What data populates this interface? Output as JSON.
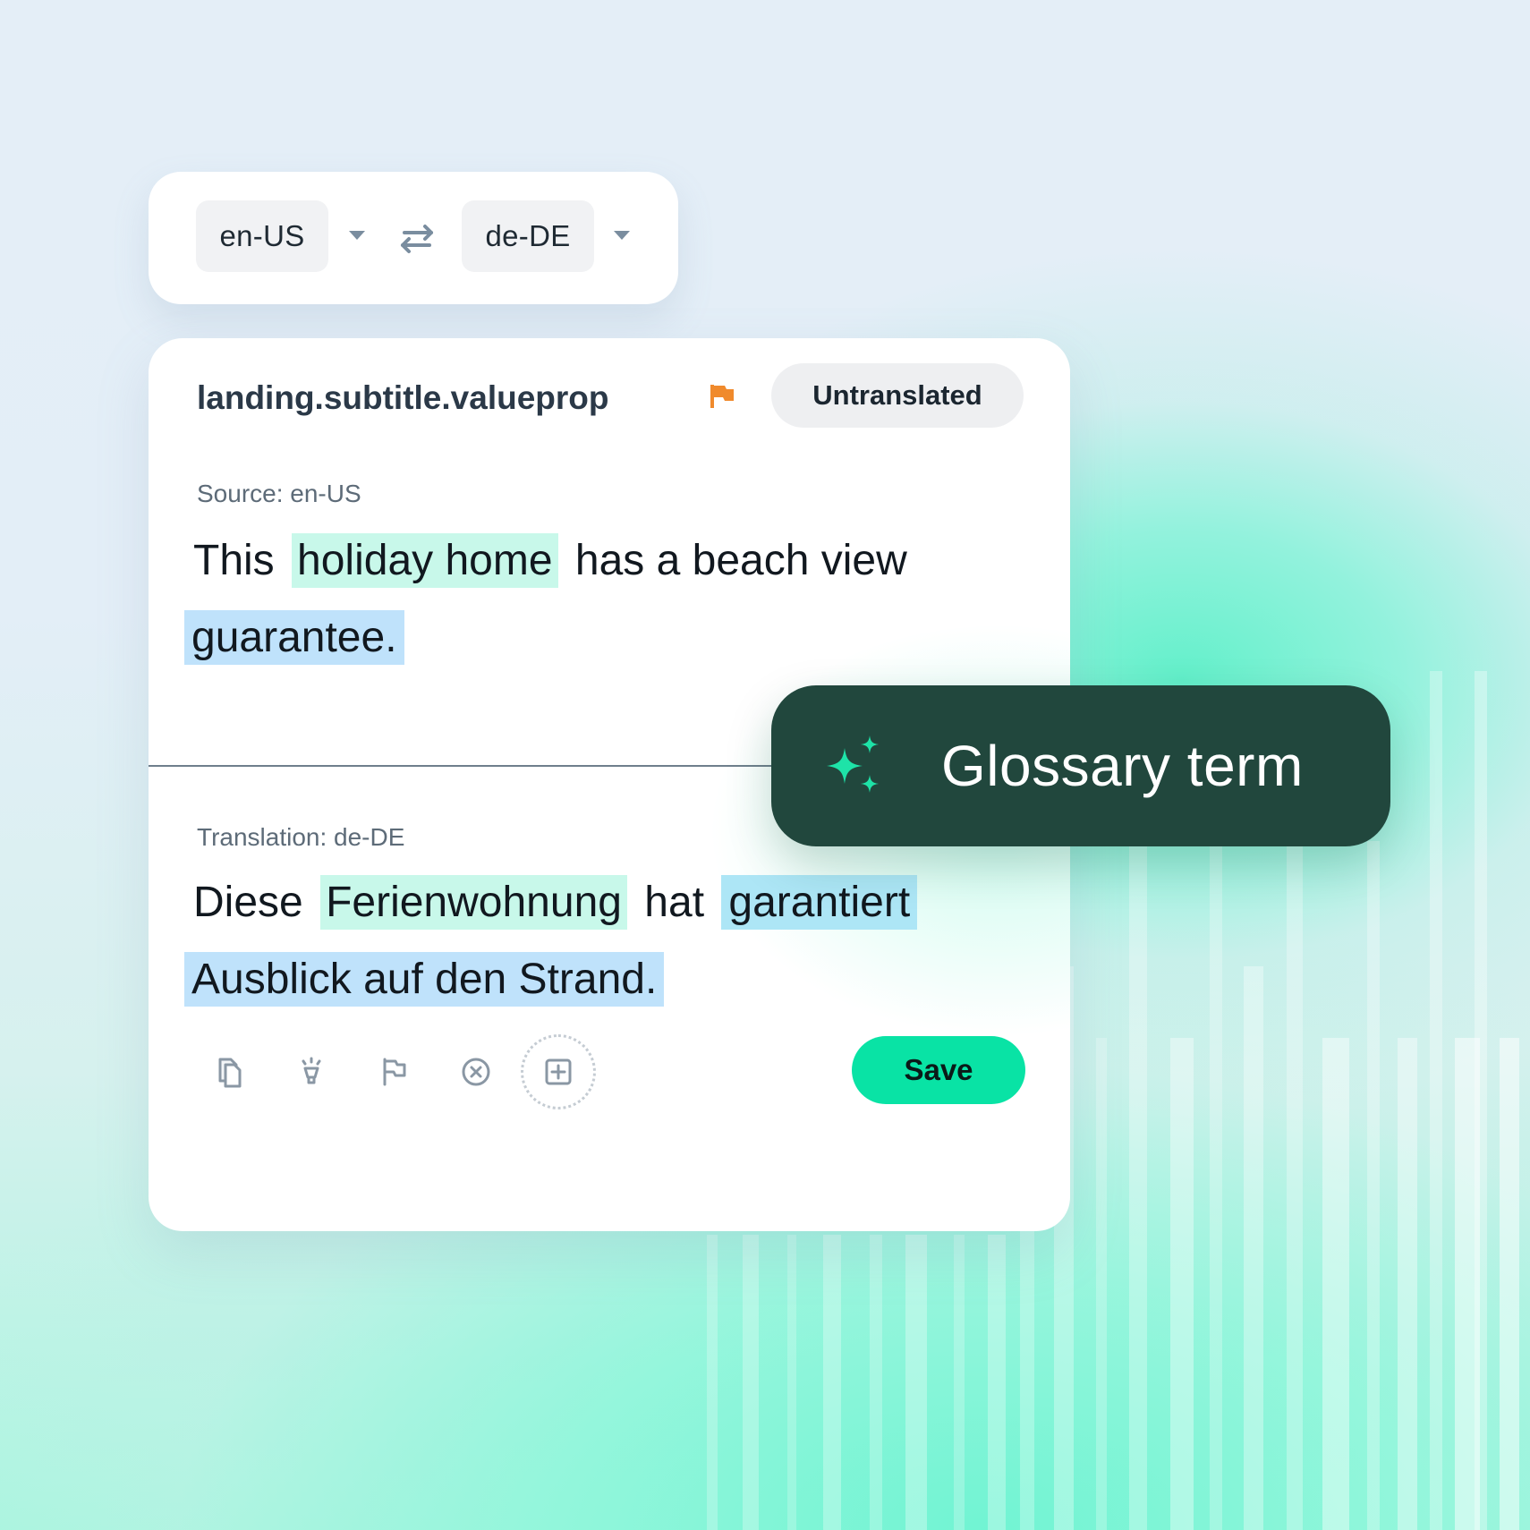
{
  "languages": {
    "source": "en-US",
    "target": "de-DE"
  },
  "entry": {
    "key": "landing.subtitle.valueprop",
    "status": "Untranslated"
  },
  "source": {
    "label": "Source: en-US",
    "segments": [
      {
        "text": "This",
        "highlight": "none"
      },
      {
        "text": "holiday home",
        "highlight": "glossary"
      },
      {
        "text": "has a beach view",
        "highlight": "none"
      },
      {
        "text": "guarantee.",
        "highlight": "phrase"
      }
    ]
  },
  "translation": {
    "label": "Translation: de-DE",
    "segments": [
      {
        "text": "Diese",
        "highlight": "none"
      },
      {
        "text": "Ferienwohnung",
        "highlight": "glossary"
      },
      {
        "text": "hat",
        "highlight": "none"
      },
      {
        "text": "garantiert",
        "highlight": "phrase-strong"
      },
      {
        "text": "Ausblick auf den Strand.",
        "highlight": "phrase"
      }
    ]
  },
  "toolbar": {
    "icons": [
      "copy-icon",
      "lightbulb-icon",
      "flag-outline-icon",
      "close-circle-icon",
      "add-box-icon"
    ],
    "save_label": "Save"
  },
  "glossary_tag": {
    "label": "Glossary term",
    "icon": "sparkle-icon"
  },
  "colors": {
    "accent": "#09e3a5",
    "glossary_highlight": "#c8f8ea",
    "phrase_highlight": "#bfe2fb",
    "tag_background": "#21473d",
    "flag": "#f08a2c"
  }
}
